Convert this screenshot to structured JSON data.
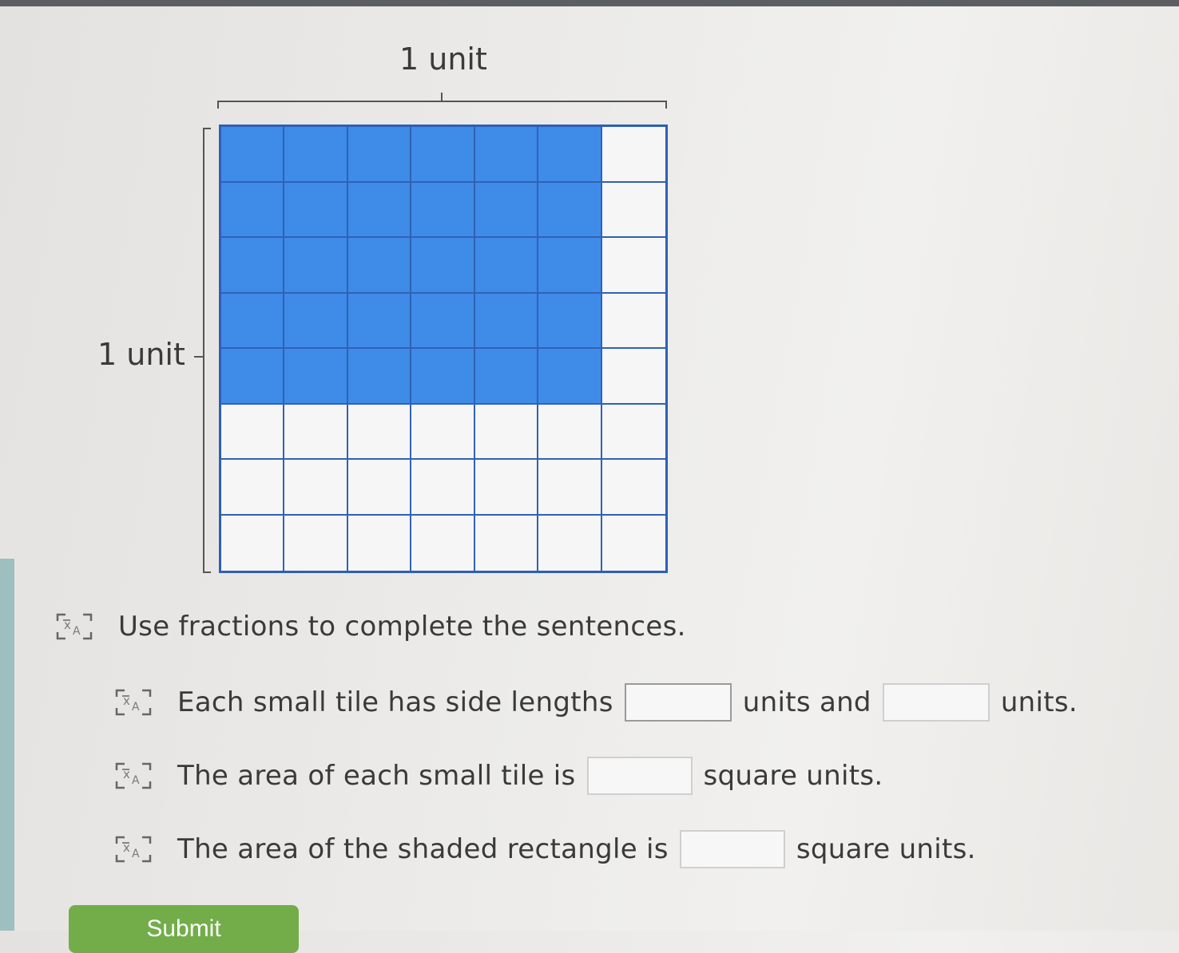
{
  "figure": {
    "top_label": "1 unit",
    "side_label": "1 unit",
    "grid": {
      "columns": 7,
      "rows": 8,
      "shaded_columns": 6,
      "shaded_rows": 5,
      "shade_color": "#3f8be8",
      "line_color": "#2f62b5"
    }
  },
  "instruction": {
    "text": "Use fractions to complete the sentences.",
    "icon": "text-to-speech-icon"
  },
  "sentences": [
    {
      "part1": "Each small tile has side lengths",
      "part2": "units and",
      "part3": "units.",
      "answers": [
        "",
        ""
      ]
    },
    {
      "part1": "The area of each small tile is",
      "part2": "square units.",
      "answers": [
        ""
      ]
    },
    {
      "part1": "The area of the shaded rectangle is",
      "part2": "square units.",
      "answers": [
        ""
      ]
    }
  ],
  "submit": {
    "label": "Submit",
    "color": "#72ad4a"
  }
}
